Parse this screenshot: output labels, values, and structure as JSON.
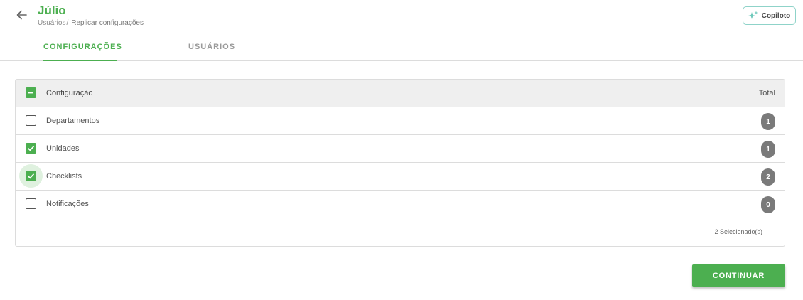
{
  "header": {
    "title": "Júlio",
    "breadcrumb": {
      "parent": "Usuários",
      "separator": "/",
      "current": "Replicar configurações"
    },
    "copilot_label": "Copiloto"
  },
  "tabs": [
    {
      "label": "CONFIGURAÇÕES",
      "active": true
    },
    {
      "label": "USUÁRIOS",
      "active": false
    }
  ],
  "table": {
    "header": {
      "label": "Configuração",
      "total": "Total",
      "select_all": "indeterminate"
    },
    "rows": [
      {
        "label": "Departamentos",
        "total": "1",
        "checked": false
      },
      {
        "label": "Unidades",
        "total": "1",
        "checked": true
      },
      {
        "label": "Checklists",
        "total": "2",
        "checked": true
      },
      {
        "label": "Notificações",
        "total": "0",
        "checked": false
      }
    ],
    "selected_count": "2 Selecionado(s)"
  },
  "actions": {
    "continue_label": "CONTINUAR"
  },
  "colors": {
    "accent": "#4caf50",
    "badge": "#7a7a7a",
    "copilot_border": "#8fd3c9"
  },
  "icons": {
    "back": "arrow-left-icon",
    "copilot": "sparkle-icon",
    "check": "check-icon",
    "indeterminate": "minus-icon"
  }
}
